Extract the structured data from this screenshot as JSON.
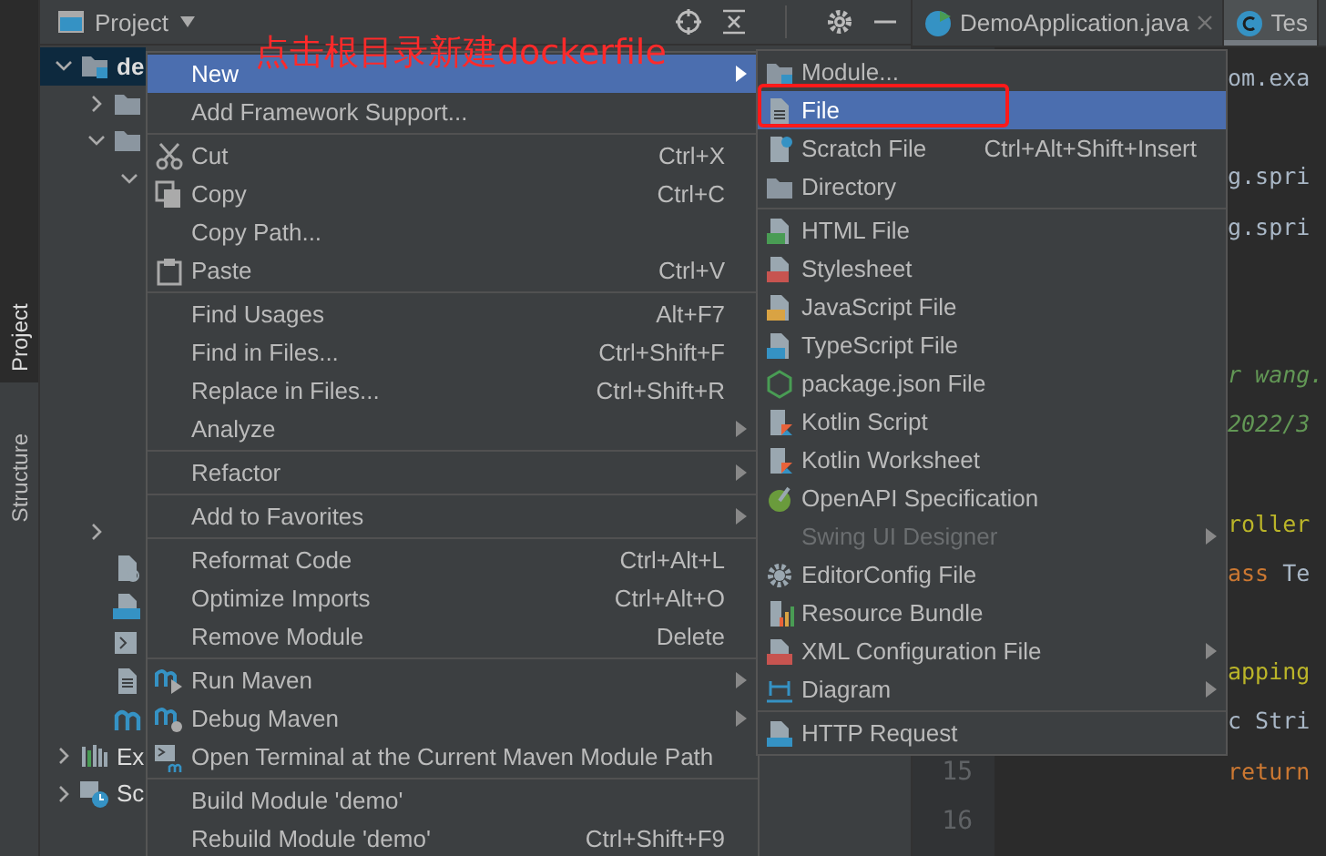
{
  "tool_strip": [
    {
      "label": "Project",
      "selected": true
    },
    {
      "label": "Structure",
      "selected": false
    }
  ],
  "project_panel": {
    "title": "Project",
    "tree_upper": [
      {
        "text": "de",
        "kind": "module",
        "expanded": true,
        "selected": true,
        "children": [
          {
            "kind": "folder",
            "expanded": false,
            "selected": false
          },
          {
            "kind": "folder",
            "expanded": true,
            "selected": false,
            "children": [
              {
                "expanded": true,
                "selected": false
              }
            ]
          }
        ]
      }
    ],
    "tree_lower": [
      {
        "kind": "continued",
        "children": [
          {
            "expanded": false,
            "selected": false
          },
          {
            "kind": "ignore-file",
            "selected": false
          },
          {
            "kind": "md-file",
            "selected": false
          },
          {
            "kind": "script-file",
            "selected": false
          },
          {
            "kind": "text-file",
            "selected": false
          },
          {
            "kind": "maven-file",
            "selected": false
          }
        ]
      },
      {
        "text": "Ex",
        "kind": "libraries",
        "expanded": false,
        "selected": false
      },
      {
        "text": "Sc",
        "kind": "scratches",
        "expanded": false,
        "selected": false
      }
    ]
  },
  "editor_tabs": [
    {
      "label": "DemoApplication.java",
      "kind": "app",
      "selected": false,
      "closable": true
    },
    {
      "label": "Tes",
      "kind": "class",
      "selected": true,
      "closable": false
    }
  ],
  "editor": {
    "lines": [
      {
        "kind": "code",
        "segments": [
          {
            "text": "om.exa",
            "kind": "plain"
          }
        ]
      },
      {
        "kind": "blank"
      },
      {
        "kind": "code",
        "segments": [
          {
            "text": "g.spri",
            "kind": "plain"
          }
        ]
      },
      {
        "kind": "code",
        "segments": [
          {
            "text": "g.spri",
            "kind": "plain"
          }
        ]
      },
      {
        "kind": "blank"
      },
      {
        "kind": "blank"
      },
      {
        "kind": "code",
        "segments": [
          {
            "text": "r wang.",
            "kind": "doc"
          }
        ]
      },
      {
        "kind": "code",
        "segments": [
          {
            "text": "2022/3",
            "kind": "doc"
          }
        ]
      },
      {
        "kind": "blank"
      },
      {
        "kind": "code",
        "segments": [
          {
            "text": "roller",
            "kind": "annotation"
          }
        ]
      },
      {
        "kind": "code",
        "segments": [
          {
            "text": "ass",
            "kind": "keyword"
          },
          {
            "text": " Te",
            "kind": "plain"
          }
        ]
      },
      {
        "kind": "blank"
      },
      {
        "kind": "code",
        "segments": [
          {
            "text": "apping",
            "kind": "annotation"
          }
        ]
      },
      {
        "kind": "code",
        "segments": [
          {
            "text": "c Stri",
            "kind": "plain"
          }
        ]
      },
      {
        "kind": "code",
        "number": "15",
        "segments": [
          {
            "text": "return",
            "kind": "keyword"
          }
        ]
      },
      {
        "kind": "blank",
        "number": "16"
      }
    ]
  },
  "context_menu": {
    "items": [
      {
        "label": "New",
        "kind": "plain",
        "selected": true,
        "submenu": true
      },
      {
        "label": "Add Framework Support...",
        "kind": "plain",
        "selected": false,
        "submenu": false
      },
      {
        "kind": "separator"
      },
      {
        "label": "Cut",
        "shortcut": "Ctrl+X",
        "kind": "cut",
        "selected": false,
        "submenu": false
      },
      {
        "label": "Copy",
        "shortcut": "Ctrl+C",
        "kind": "copy",
        "selected": false,
        "submenu": false
      },
      {
        "label": "Copy Path...",
        "kind": "plain",
        "selected": false,
        "submenu": false
      },
      {
        "label": "Paste",
        "shortcut": "Ctrl+V",
        "kind": "paste",
        "selected": false,
        "submenu": false
      },
      {
        "kind": "separator"
      },
      {
        "label": "Find Usages",
        "shortcut": "Alt+F7",
        "kind": "plain",
        "selected": false,
        "submenu": false
      },
      {
        "label": "Find in Files...",
        "shortcut": "Ctrl+Shift+F",
        "kind": "plain",
        "selected": false,
        "submenu": false
      },
      {
        "label": "Replace in Files...",
        "shortcut": "Ctrl+Shift+R",
        "kind": "plain",
        "selected": false,
        "submenu": false
      },
      {
        "label": "Analyze",
        "kind": "plain",
        "selected": false,
        "submenu": true
      },
      {
        "kind": "separator"
      },
      {
        "label": "Refactor",
        "kind": "plain",
        "selected": false,
        "submenu": true
      },
      {
        "kind": "separator"
      },
      {
        "label": "Add to Favorites",
        "kind": "plain",
        "selected": false,
        "submenu": true
      },
      {
        "kind": "separator"
      },
      {
        "label": "Reformat Code",
        "shortcut": "Ctrl+Alt+L",
        "kind": "plain",
        "selected": false,
        "submenu": false
      },
      {
        "label": "Optimize Imports",
        "shortcut": "Ctrl+Alt+O",
        "kind": "plain",
        "selected": false,
        "submenu": false
      },
      {
        "label": "Remove Module",
        "shortcut": "Delete",
        "kind": "plain",
        "selected": false,
        "submenu": false
      },
      {
        "kind": "separator"
      },
      {
        "label": "Run Maven",
        "kind": "run-maven",
        "selected": false,
        "submenu": true
      },
      {
        "label": "Debug Maven",
        "kind": "debug-maven",
        "selected": false,
        "submenu": true
      },
      {
        "label": "Open Terminal at the Current Maven Module Path",
        "kind": "terminal",
        "selected": false,
        "submenu": false
      },
      {
        "kind": "separator"
      },
      {
        "label": "Build Module 'demo'",
        "kind": "plain",
        "selected": false,
        "submenu": false
      },
      {
        "label": "Rebuild Module 'demo'",
        "shortcut": "Ctrl+Shift+F9",
        "kind": "plain",
        "selected": false,
        "submenu": false
      }
    ]
  },
  "new_submenu": {
    "items": [
      {
        "label": "Module...",
        "kind": "module",
        "selected": false,
        "disabled": false,
        "submenu": false,
        "outlined": false
      },
      {
        "label": "File",
        "kind": "file",
        "selected": true,
        "disabled": false,
        "submenu": false,
        "outlined": true
      },
      {
        "label": "Scratch File",
        "shortcut": "Ctrl+Alt+Shift+Insert",
        "kind": "scratch",
        "selected": false,
        "disabled": false,
        "submenu": false,
        "outlined": false
      },
      {
        "label": "Directory",
        "kind": "directory",
        "selected": false,
        "disabled": false,
        "submenu": false,
        "outlined": false
      },
      {
        "kind": "separator"
      },
      {
        "label": "HTML File",
        "kind": "html",
        "selected": false,
        "disabled": false,
        "submenu": false,
        "outlined": false
      },
      {
        "label": "Stylesheet",
        "kind": "css",
        "selected": false,
        "disabled": false,
        "submenu": false,
        "outlined": false
      },
      {
        "label": "JavaScript File",
        "kind": "js",
        "selected": false,
        "disabled": false,
        "submenu": false,
        "outlined": false
      },
      {
        "label": "TypeScript File",
        "kind": "ts",
        "selected": false,
        "disabled": false,
        "submenu": false,
        "outlined": false
      },
      {
        "label": "package.json File",
        "kind": "npm",
        "selected": false,
        "disabled": false,
        "submenu": false,
        "outlined": false
      },
      {
        "label": "Kotlin Script",
        "kind": "kotlin",
        "selected": false,
        "disabled": false,
        "submenu": false,
        "outlined": false
      },
      {
        "label": "Kotlin Worksheet",
        "kind": "kotlin",
        "selected": false,
        "disabled": false,
        "submenu": false,
        "outlined": false
      },
      {
        "label": "OpenAPI Specification",
        "kind": "openapi",
        "selected": false,
        "disabled": false,
        "submenu": false,
        "outlined": false
      },
      {
        "label": "Swing UI Designer",
        "kind": "none",
        "selected": false,
        "disabled": true,
        "submenu": true,
        "outlined": false
      },
      {
        "label": "EditorConfig File",
        "kind": "gear",
        "selected": false,
        "disabled": false,
        "submenu": false,
        "outlined": false
      },
      {
        "label": "Resource Bundle",
        "kind": "bundle",
        "selected": false,
        "disabled": false,
        "submenu": false,
        "outlined": false
      },
      {
        "label": "XML Configuration File",
        "kind": "xml",
        "selected": false,
        "disabled": false,
        "submenu": true,
        "outlined": false
      },
      {
        "label": "Diagram",
        "kind": "diagram",
        "selected": false,
        "disabled": false,
        "submenu": true,
        "outlined": false
      },
      {
        "kind": "separator"
      },
      {
        "label": "HTTP Request",
        "kind": "http",
        "selected": false,
        "disabled": false,
        "submenu": false,
        "outlined": false
      }
    ]
  },
  "annotation": {
    "text": "点击根目录新建dockerfile"
  }
}
